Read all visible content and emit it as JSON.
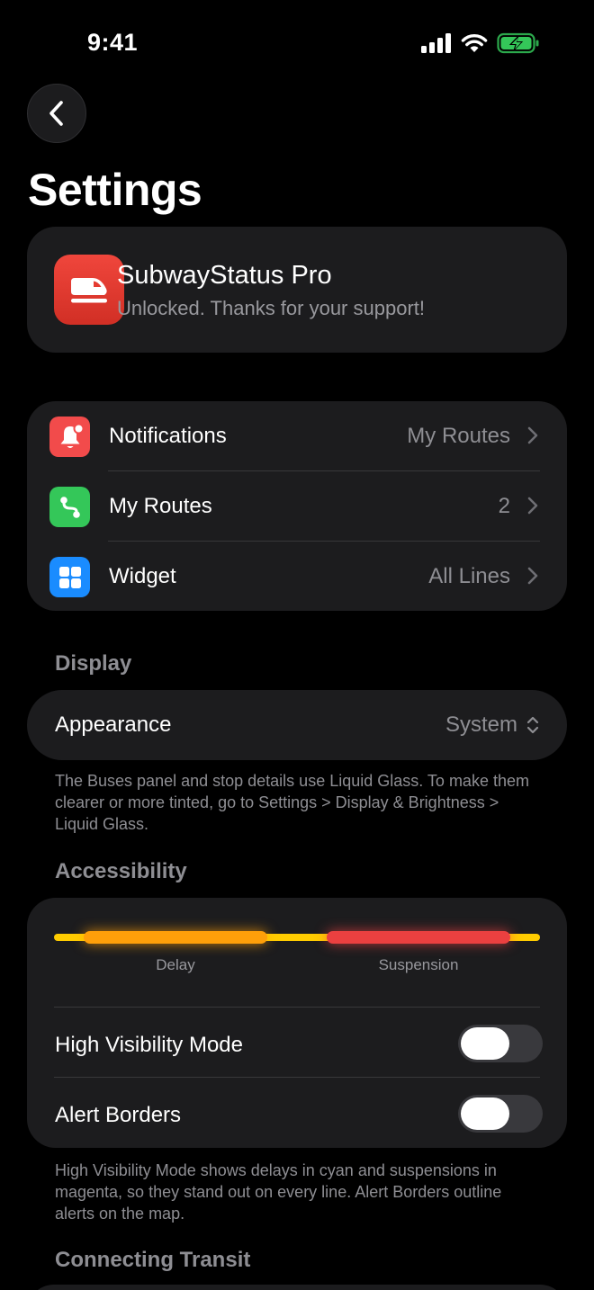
{
  "status_bar": {
    "time": "9:41",
    "signal_icon": "cellular-signal-icon",
    "wifi_icon": "wifi-icon",
    "battery_icon": "battery-charging-icon",
    "battery_color": "#34c759"
  },
  "header": {
    "back_icon": "chevron-left-icon",
    "title": "Settings"
  },
  "pro": {
    "icon": "train-icon",
    "name": "SubwayStatus Pro",
    "subtitle": "Unlocked. Thanks for your support!",
    "icon_color": "#e53b31"
  },
  "menu": {
    "items": [
      {
        "icon": "bell-icon",
        "icon_color": "#f24b4b",
        "label": "Notifications",
        "value": "My Routes"
      },
      {
        "icon": "route-icon",
        "icon_color": "#34c759",
        "label": "My Routes",
        "value": "2"
      },
      {
        "icon": "grid-icon",
        "icon_color": "#1a8cff",
        "label": "Widget",
        "value": "All Lines"
      }
    ]
  },
  "display": {
    "header": "Display",
    "appearance_label": "Appearance",
    "appearance_value": "System",
    "footnote": "The Buses panel and stop details use Liquid Glass. To make them clearer or more tinted, go to Settings > Display & Brightness > Liquid Glass."
  },
  "accessibility": {
    "header": "Accessibility",
    "delay_label": "Delay",
    "suspension_label": "Suspension",
    "colors": {
      "line": "#ffcc00",
      "delay": "#ff9f0a",
      "suspension": "#eb4040"
    },
    "high_visibility_label": "High Visibility Mode",
    "high_visibility_on": false,
    "alert_borders_label": "Alert Borders",
    "alert_borders_on": false,
    "footnote": "High Visibility Mode shows delays in cyan and suspensions in magenta, so they stand out on every line. Alert Borders outline alerts on the map."
  },
  "connecting": {
    "header": "Connecting Transit"
  }
}
